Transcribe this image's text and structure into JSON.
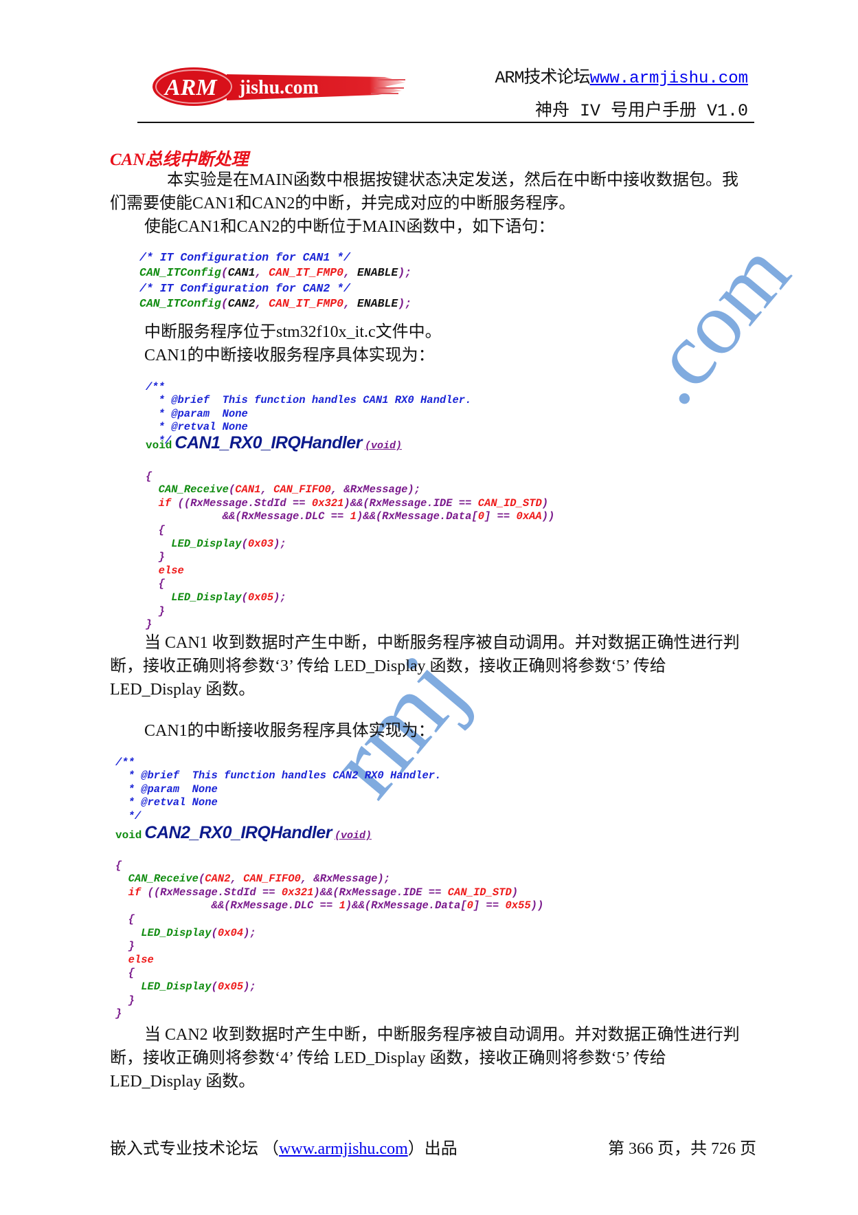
{
  "header": {
    "logo": {
      "brand": "ARM",
      "suffix": "jishu.com"
    },
    "forum_label": "ARM技术论坛",
    "forum_link": "www.armjishu.com",
    "manual_title": "神舟 IV 号用户手册 V1.0"
  },
  "section": {
    "title": "CAN总线中断处理",
    "intro_line1": "本实验是在MAIN函数中根据按键状态决定发送，然后在中断中接收数据包。我",
    "intro_line2": "们需要使能CAN1和CAN2的中断，并完成对应的中断服务程序。",
    "enable_line": "使能CAN1和CAN2的中断位于MAIN函数中，如下语句：",
    "config_code": {
      "cmt1": "/* IT Configuration for CAN1 */",
      "fn1": "CAN_ITConfig",
      "arg1a": "CAN1",
      "arg1b": "CAN_IT_FMP0",
      "arg1c": "ENABLE",
      "cmt2": "/* IT Configuration for CAN2 */",
      "fn2": "CAN_ITConfig",
      "arg2a": "CAN2",
      "arg2b": "CAN_IT_FMP0",
      "arg2c": "ENABLE"
    },
    "isr_location": "中断服务程序位于stm32f10x_it.c文件中。",
    "can1_intro": "CAN1的中断接收服务程序具体实现为：",
    "can1_code": {
      "doc_open": "/**",
      "brief": "  * @brief  This function handles CAN1 RX0 Handler.",
      "param": "  * @param  None",
      "retval": "  * @retval None",
      "doc_close": "  */",
      "void_kw": "void",
      "func_name": "CAN1_RX0_IRQHandler",
      "func_arg": "(void)",
      "open_brace": "{",
      "recv_fn": "CAN_Receive",
      "recv_a": "CAN1",
      "recv_b": "CAN_FIFO0",
      "recv_c": "&RxMessage",
      "if_kw": "if",
      "cond1": "((RxMessage.StdId == ",
      "cond1v": "0x321",
      "cond2": ")&&(RxMessage.IDE == ",
      "cond2v": "CAN_ID_STD",
      "cond3": "&&(RxMessage.DLC == ",
      "cond3v": "1",
      "cond4": ")&&(RxMessage.Data[",
      "cond4i": "0",
      "cond4b": "] == ",
      "cond4v": "0xAA",
      "led_fn": "LED_Display",
      "led_ok": "0x03",
      "else_kw": "else",
      "led_err": "0x05"
    },
    "can1_desc_line1": "当 CAN1 收到数据时产生中断，中断服务程序被自动调用。并对数据正确性进行判",
    "can1_desc_line2": "断，接收正确则将参数‘3’ 传给 LED_Display 函数，接收正确则将参数‘5’ 传给",
    "can1_desc_line3": "LED_Display 函数。",
    "can2_intro": "CAN1的中断接收服务程序具体实现为：",
    "can2_code": {
      "doc_open": "/**",
      "brief": "  * @brief  This function handles CAN2 RX0 Handler.",
      "param": "  * @param  None",
      "retval": "  * @retval None",
      "doc_close": "  */",
      "void_kw": "void",
      "func_name": "CAN2_RX0_IRQHandler",
      "func_arg": "(void)",
      "open_brace": "{",
      "recv_fn": "CAN_Receive",
      "recv_a": "CAN2",
      "recv_b": "CAN_FIFO0",
      "recv_c": "&RxMessage",
      "if_kw": "if",
      "cond1": "((RxMessage.StdId == ",
      "cond1v": "0x321",
      "cond2": ")&&(RxMessage.IDE == ",
      "cond2v": "CAN_ID_STD",
      "cond3": "&&(RxMessage.DLC == ",
      "cond3v": "1",
      "cond4": ")&&(RxMessage.Data[",
      "cond4i": "0",
      "cond4b": "] == ",
      "cond4v": "0x55",
      "led_fn": "LED_Display",
      "led_ok": "0x04",
      "else_kw": "else",
      "led_err": "0x05"
    },
    "can2_desc_line1": "当 CAN2 收到数据时产生中断，中断服务程序被自动调用。并对数据正确性进行判",
    "can2_desc_line2": "断，接收正确则将参数‘4’ 传给 LED_Display 函数，接收正确则将参数‘5’ 传给",
    "can2_desc_line3": "LED_Display 函数。"
  },
  "footer": {
    "left_prefix": "嵌入式专业技术论坛 （",
    "left_link": "www.armjishu.com",
    "left_suffix": "）出品",
    "page_current": "366",
    "page_total": "726",
    "page_text_a": "第 ",
    "page_text_b": " 页，共 ",
    "page_text_c": " 页"
  },
  "watermark": {
    "text_a": ".com",
    "text_b": "rmj"
  },
  "colors": {
    "title_red": "#e8101a",
    "comment_blue": "#1a24d6",
    "function_green": "#108c10",
    "literal_red": "#ee1a1a",
    "variable_purple": "#7a1a8c",
    "link_blue": "#0000ee",
    "watermark_blue": "#7aa7de"
  }
}
